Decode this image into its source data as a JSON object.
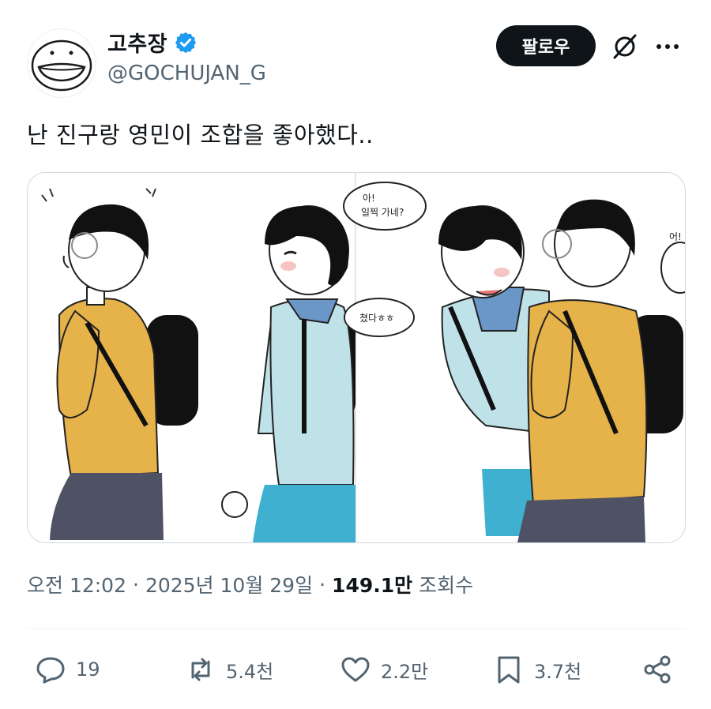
{
  "author": {
    "display_name": "고추장",
    "handle": "@GOCHUJAN_G",
    "verified_color": "#1d9bf0"
  },
  "follow_label": "팔로우",
  "tweet": {
    "text": "난 진구랑 영민이 조합을 좋아했다.."
  },
  "comic": {
    "bubble_1_line_1": "아!",
    "bubble_1_line_2": "일찍 가네?",
    "bubble_2": "쳤다ㅎㅎ",
    "bubble_3": "어!"
  },
  "meta": {
    "time": "오전 12:02",
    "date": "2025년 10월 29일",
    "views_count": "149.1만",
    "views_label": "조회수",
    "separator": "·"
  },
  "actions": {
    "replies": "19",
    "reposts": "5.4천",
    "likes": "2.2만",
    "bookmarks": "3.7천"
  },
  "icons": {
    "verified": "verified-badge-icon",
    "grok": "grok-icon",
    "more": "more-icon",
    "reply": "reply-icon",
    "repost": "repost-icon",
    "like": "heart-icon",
    "bookmark": "bookmark-icon",
    "share": "share-icon"
  },
  "colors": {
    "text_primary": "#0f1419",
    "text_secondary": "#536471",
    "follow_bg": "#0f1419",
    "yellow_sweater": "#e6b24a",
    "blue_sweater": "#bfe1e8",
    "shorts_navy": "#4f5265",
    "shorts_teal": "#3fb0cf"
  }
}
